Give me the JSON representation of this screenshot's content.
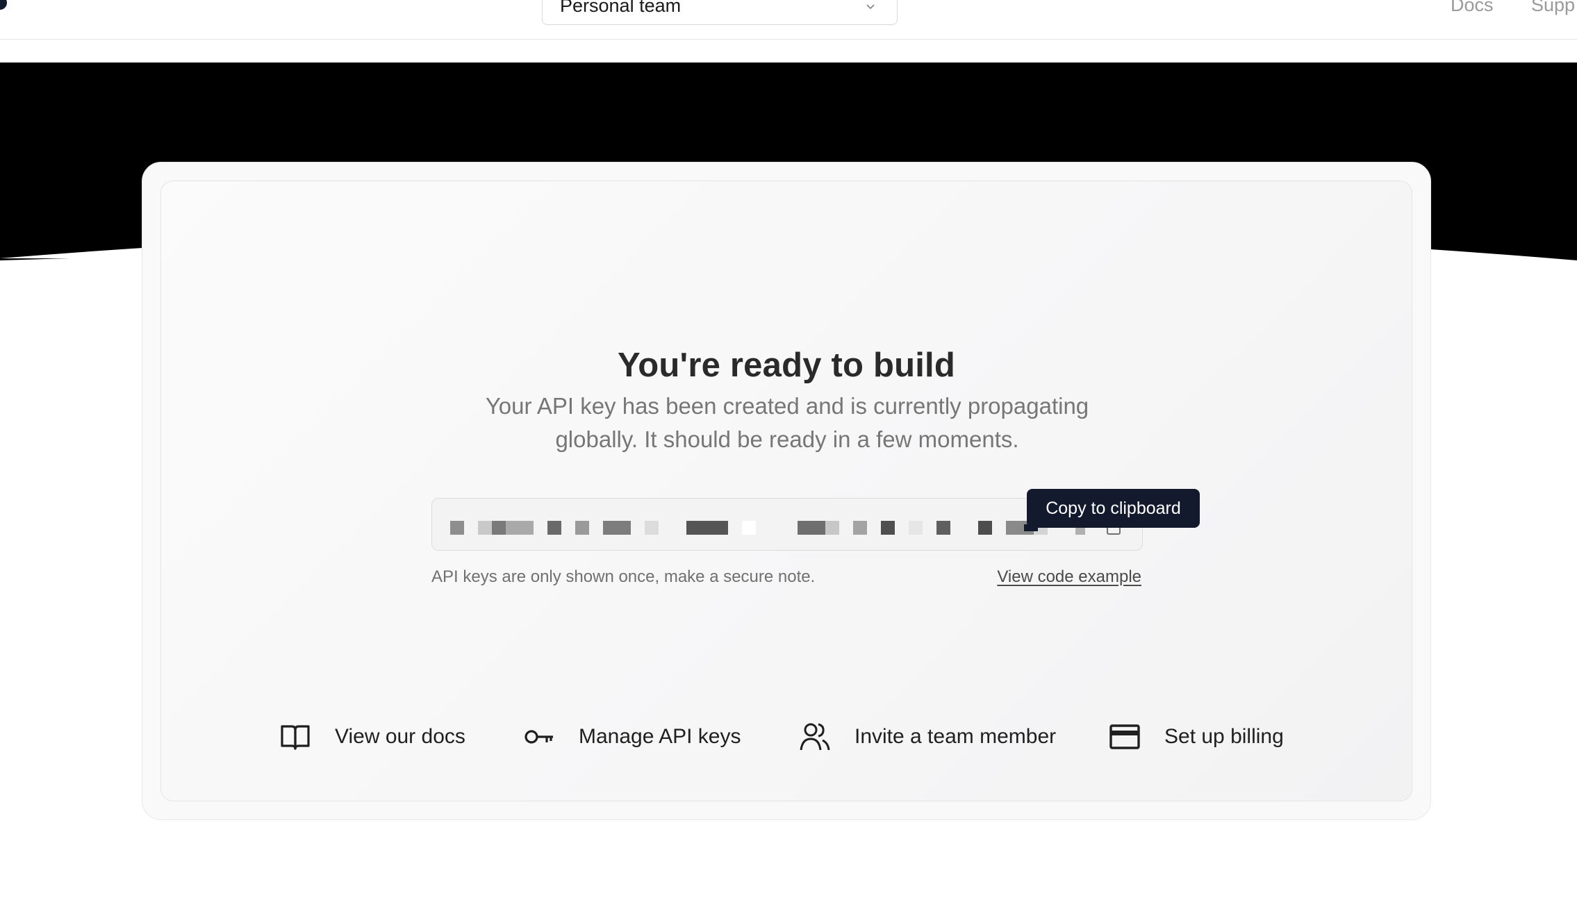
{
  "header": {
    "team_select": {
      "value": "Personal team"
    },
    "nav": [
      {
        "label": "Docs"
      },
      {
        "label": "Supp"
      }
    ]
  },
  "card": {
    "title": "You're ready to build",
    "subtitle": "Your API key has been created and is currently propagating globally. It should be ready in a few moments.",
    "api_key_tooltip": "Copy to clipboard",
    "note": "API keys are only shown once, make a secure note.",
    "code_link": "View code example",
    "actions": [
      {
        "label": "View our docs",
        "icon": "book-icon"
      },
      {
        "label": "Manage API keys",
        "icon": "key-icon"
      },
      {
        "label": "Invite a team member",
        "icon": "users-icon"
      },
      {
        "label": "Set up billing",
        "icon": "credit-card-icon"
      }
    ]
  },
  "colors": {
    "tooltip_bg": "#141a2e",
    "hero_band": "#000000",
    "card_bg": "#f9f9f9"
  }
}
